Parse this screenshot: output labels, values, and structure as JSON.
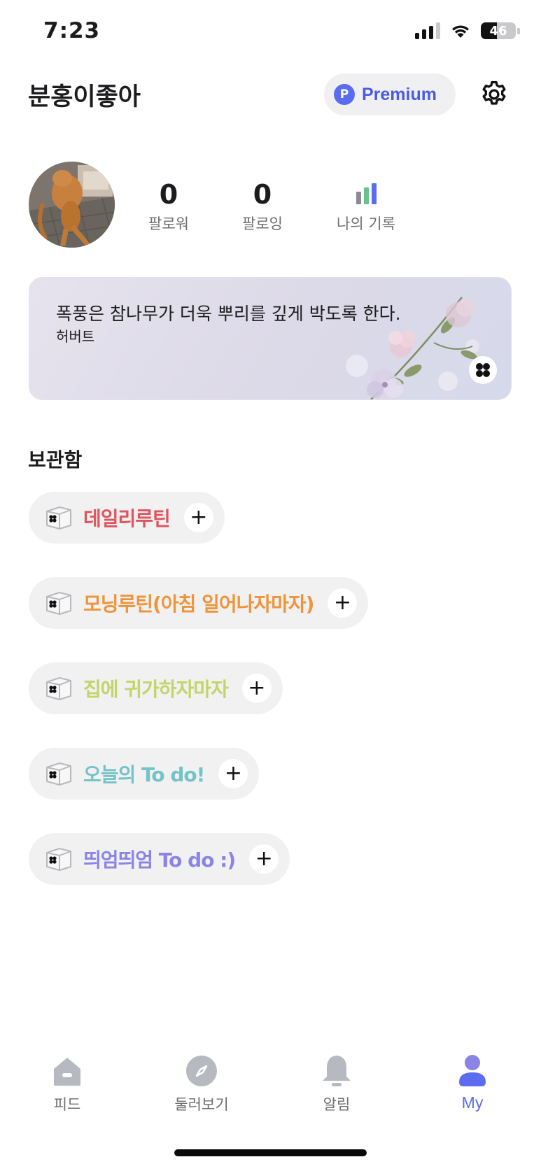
{
  "status_bar": {
    "time": "7:23",
    "battery": "46",
    "battery_level": 0.46
  },
  "header": {
    "title": "분홍이좋아",
    "premium_label": "Premium",
    "premium_badge": "P"
  },
  "profile": {
    "followers": {
      "count": "0",
      "label": "팔로워"
    },
    "following": {
      "count": "0",
      "label": "팔로잉"
    },
    "records": {
      "label": "나의 기록"
    }
  },
  "quote": {
    "text": "폭풍은 참나무가 더욱 뿌리를 깊게 박도록 한다.",
    "author": "허버트"
  },
  "storage": {
    "title": "보관함",
    "folders": [
      {
        "label": "데일리루틴",
        "color": "#e0545f"
      },
      {
        "label": "모닝루틴(아침 일어나자마자)",
        "color": "#f0943a"
      },
      {
        "label": "집에 귀가하자마자",
        "color": "#c3d46a"
      },
      {
        "label": "오늘의 To do!",
        "color": "#74c3c6"
      },
      {
        "label": "띄엄띄엄 To do :)",
        "color": "#8b84e6"
      }
    ],
    "add_label": "+"
  },
  "tabs": [
    {
      "label": "피드",
      "icon": "home-icon"
    },
    {
      "label": "둘러보기",
      "icon": "compass-icon"
    },
    {
      "label": "알림",
      "icon": "bell-icon"
    },
    {
      "label": "My",
      "icon": "person-icon"
    }
  ],
  "colors": {
    "accent": "#5b6cf0",
    "icon_gray": "#b7b9c0"
  }
}
